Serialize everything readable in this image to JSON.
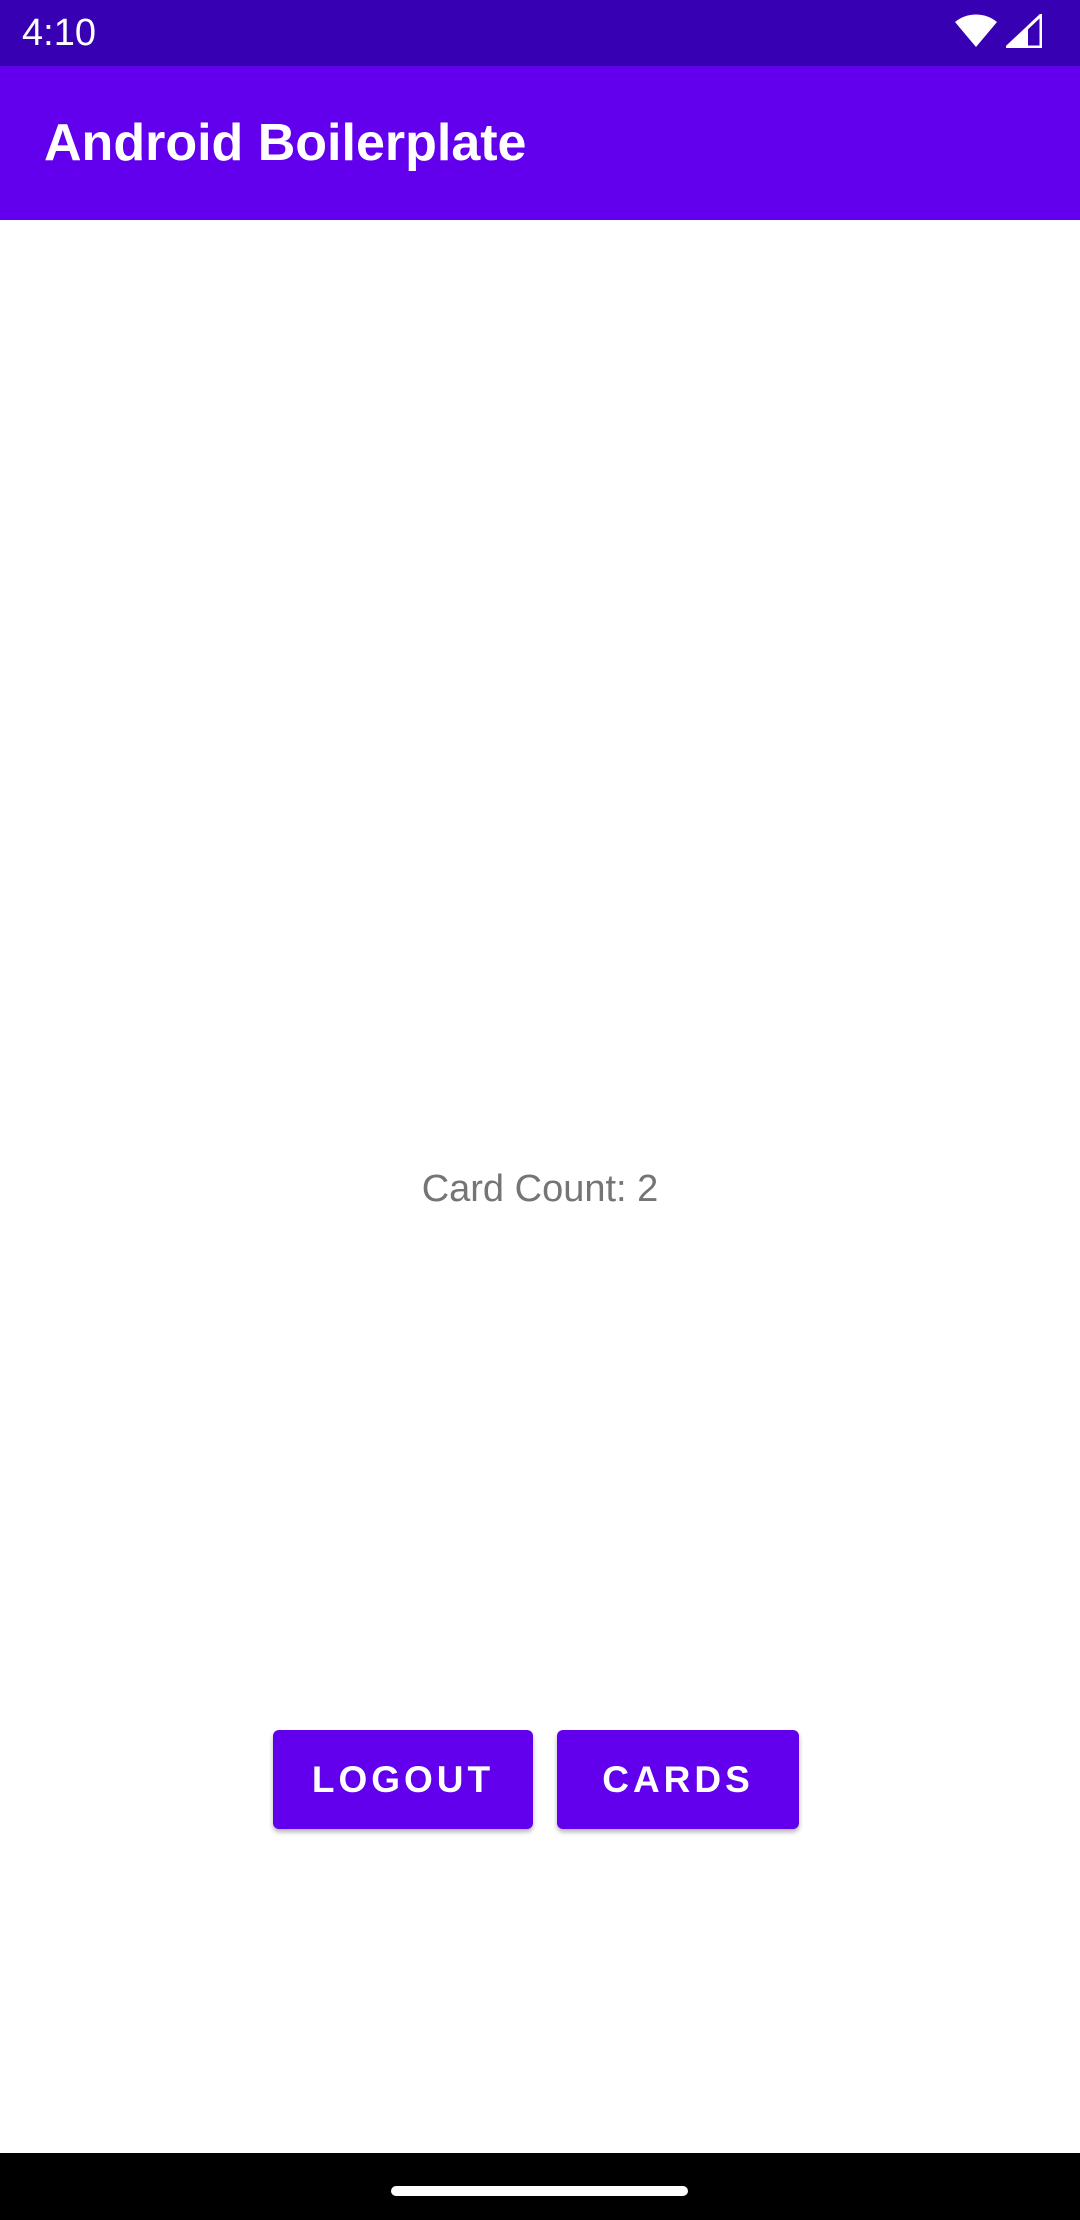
{
  "status_bar": {
    "time": "4:10",
    "icons": [
      "wifi-icon",
      "cellular-signal-icon"
    ],
    "background": "#3700b3"
  },
  "app_bar": {
    "title": "Android Boilerplate",
    "background": "#6200ee"
  },
  "main": {
    "card_count_text": "Card Count: 2"
  },
  "actions": {
    "logout_label": "LOGOUT",
    "cards_label": "CARDS",
    "button_color": "#6200ee"
  },
  "nav_bar": {
    "background": "#000000",
    "handle": "home-gesture-handle"
  }
}
